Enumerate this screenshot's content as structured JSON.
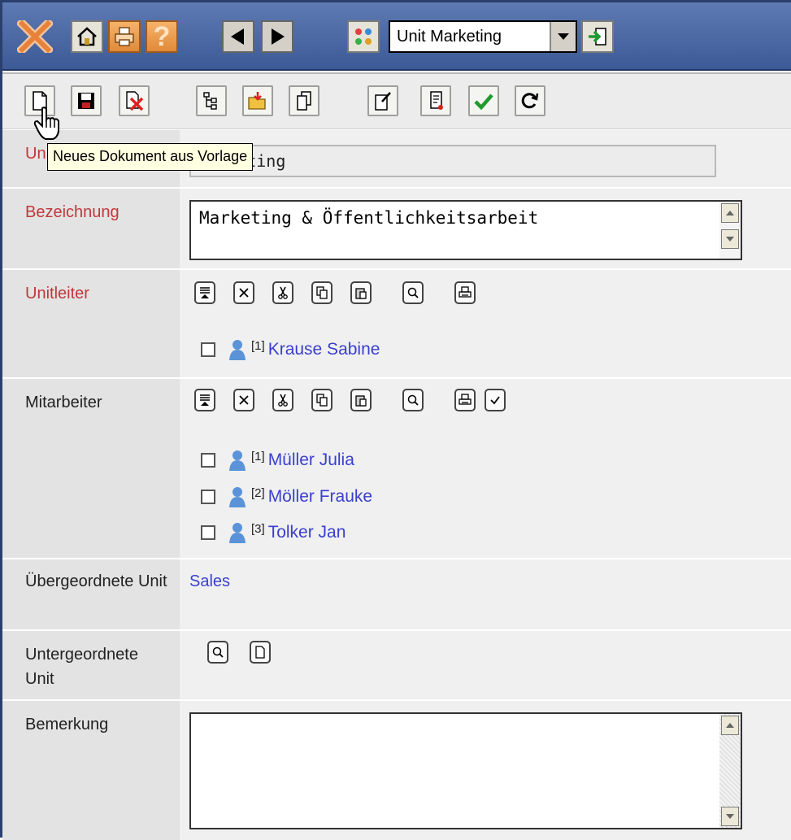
{
  "header": {
    "unit_select_value": "Unit Marketing"
  },
  "toolbar2": {
    "tooltip": "Neues Dokument aus Vorlage"
  },
  "form": {
    "unit": {
      "label": "Unit",
      "value": "Marketing"
    },
    "bezeichnung": {
      "label": "Bezeichnung",
      "value": "Marketing & Öffentlichkeitsarbeit"
    },
    "unitleiter": {
      "label": "Unitleiter",
      "people": [
        {
          "index": "[1]",
          "name": "Krause Sabine"
        }
      ]
    },
    "mitarbeiter": {
      "label": "Mitarbeiter",
      "people": [
        {
          "index": "[1]",
          "name": "Müller Julia"
        },
        {
          "index": "[2]",
          "name": "Möller Frauke"
        },
        {
          "index": "[3]",
          "name": "Tolker Jan"
        }
      ]
    },
    "uebergeordnete_unit": {
      "label": "Übergeordnete Unit",
      "value": "Sales"
    },
    "untergeordnete_unit": {
      "label": "Untergeordnete Unit"
    },
    "bemerkung": {
      "label": "Bemerkung",
      "value": ""
    }
  },
  "colors": {
    "header_blue": "#3c5a96",
    "required_label_red": "#c0383a",
    "link_blue": "#3a3fcf"
  },
  "icons": {
    "topbar": [
      "close-icon",
      "home-icon",
      "print-icon",
      "help-icon",
      "back-arrow-icon",
      "forward-arrow-icon",
      "units-icon",
      "dropdown-arrow-icon",
      "go-icon"
    ],
    "toolbar2": [
      "new-document-icon",
      "save-icon",
      "delete-icon",
      "tree-icon",
      "open-folder-icon",
      "copy-document-icon",
      "properties-icon",
      "log-icon",
      "check-icon",
      "refresh-icon"
    ]
  }
}
